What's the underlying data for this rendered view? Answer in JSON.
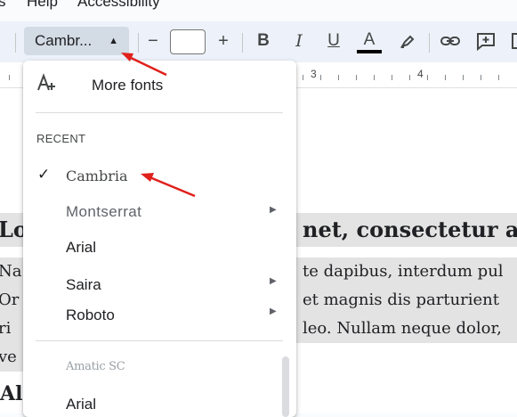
{
  "menubar": {
    "items": [
      "s",
      "Help",
      "Accessibility"
    ]
  },
  "toolbar": {
    "font_name": "Cambr...",
    "font_caret": "▲",
    "decrease_size": "−",
    "increase_size": "+",
    "bold": "B",
    "italic": "I",
    "underline": "U",
    "text_color": "A",
    "text_color_underline": "#000000"
  },
  "ruler": {
    "numbers": [
      "3",
      "4"
    ]
  },
  "font_menu": {
    "more_fonts_label": "More fonts",
    "recent_label": "RECENT",
    "recent": [
      {
        "label": "Cambria",
        "checked": true,
        "submenu": false
      },
      {
        "label": "Montserrat",
        "checked": false,
        "submenu": true
      },
      {
        "label": "Arial",
        "checked": false,
        "submenu": false
      },
      {
        "label": "Saira",
        "checked": false,
        "submenu": true
      },
      {
        "label": "Roboto",
        "checked": false,
        "submenu": true
      }
    ],
    "all": [
      {
        "label": "Amatic SC"
      },
      {
        "label": "Arial"
      }
    ]
  },
  "document": {
    "heading_left": "Lo",
    "heading_right": "net, consectetur ac",
    "lines": [
      {
        "left": "Na",
        "right": "te dapibus, interdum pul"
      },
      {
        "left": "Or",
        "right": "et magnis dis parturient"
      },
      {
        "left": "ri",
        "right": "leo. Nullam neque dolor,"
      },
      {
        "left": "ve",
        "right": ""
      }
    ],
    "heading2_left": "Ali"
  },
  "colors": {
    "annotation_arrow": "#e0201b",
    "toolbar_bg": "#edf2fa",
    "highlight": "#e3e3e3"
  }
}
